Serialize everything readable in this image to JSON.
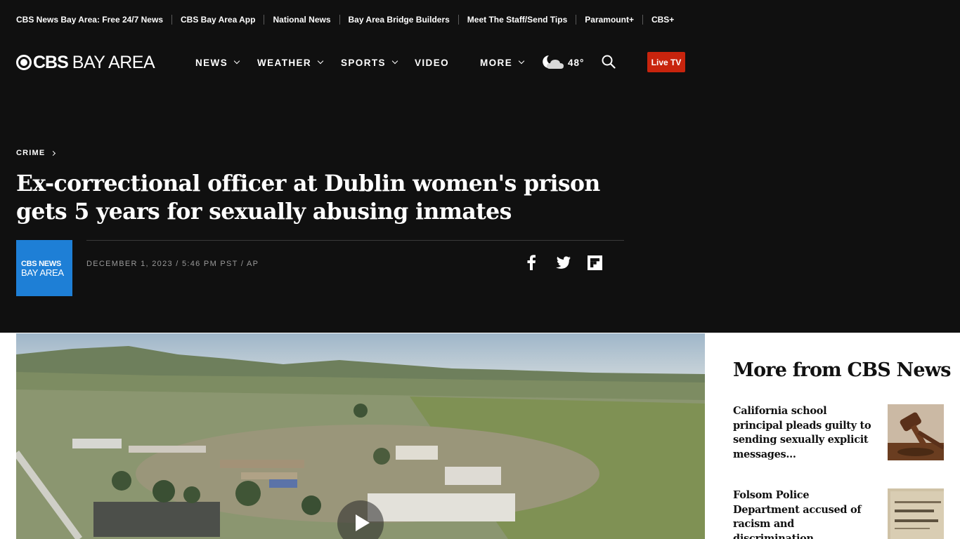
{
  "utility_links": [
    "CBS News Bay Area: Free 24/7 News",
    "CBS Bay Area App",
    "National News",
    "Bay Area Bridge Builders",
    "Meet The Staff/Send Tips",
    "Paramount+",
    "CBS+"
  ],
  "logo": {
    "brand": "CBS",
    "region": "BAY AREA"
  },
  "nav": {
    "news": "NEWS",
    "weather": "WEATHER",
    "sports": "SPORTS",
    "video": "VIDEO",
    "more": "MORE"
  },
  "weather": {
    "temperature": "48°",
    "icon": "partly-cloudy-night-icon"
  },
  "live_tv": "Live TV",
  "article": {
    "category": "CRIME",
    "headline": "Ex-correctional officer at Dublin women's prison gets 5 years for sexually abusing inmates",
    "author_logo_line1": "CBS NEWS",
    "author_logo_line2": "BAY AREA",
    "byline": "DECEMBER 1, 2023 / 5:46 PM PST / AP"
  },
  "sidebar": {
    "title": "More from CBS News",
    "stories": [
      {
        "headline": "California school principal pleads guilty to sending sexually explicit messages...",
        "thumb": "gavel"
      },
      {
        "headline": "Folsom Police Department accused of racism and discrimination",
        "thumb": "police-sign"
      }
    ]
  },
  "colors": {
    "header_bg": "#101010",
    "live_red": "#c8240d",
    "author_blue": "#1e7fd6"
  }
}
